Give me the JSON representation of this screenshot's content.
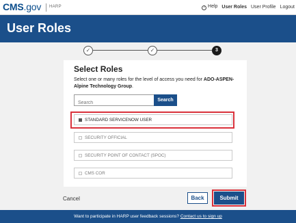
{
  "header": {
    "logo_main": "CMS",
    "logo_suffix": ".gov",
    "app_name": "HARP",
    "help_label": "Help",
    "user_roles_label": "User Roles",
    "user_profile_label": "User Profile",
    "logout_label": "Logout"
  },
  "banner": {
    "title": "User Roles"
  },
  "stepper": {
    "steps": [
      "",
      "",
      "3"
    ],
    "current_step": 3
  },
  "form": {
    "heading": "Select Roles",
    "description_prefix": "Select one or many roles for the level of access you need for ",
    "org_name": "ADO-ASPEN-Alpine Technology Group",
    "description_suffix": ".",
    "search": {
      "placeholder": "Search",
      "button_label": "Search"
    },
    "roles": [
      {
        "label": "STANDARD SERVICENOW USER",
        "selected": true
      },
      {
        "label": "SECURITY OFFICIAL",
        "selected": false
      },
      {
        "label": "SECURITY POINT OF CONTACT (SPOC)",
        "selected": false
      },
      {
        "label": "CMS COR",
        "selected": false
      }
    ]
  },
  "actions": {
    "cancel_label": "Cancel",
    "back_label": "Back",
    "submit_label": "Submit"
  },
  "footer": {
    "prompt": "Want to participate in HARP user feedback sessions? ",
    "link_label": "Contact us to sign up"
  },
  "colors": {
    "primary": "#1b4f8a",
    "highlight": "#d9303a"
  }
}
